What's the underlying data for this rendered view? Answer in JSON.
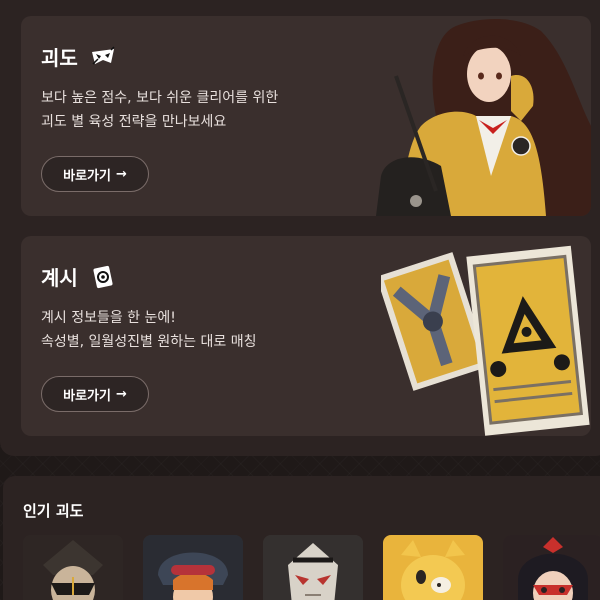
{
  "cards": [
    {
      "title": "괴도",
      "icon": "mask-icon",
      "desc_line1": "보다 높은 점수, 보다 쉬운 클리어를 위한",
      "desc_line2": "괴도 별 육성 전략을 만나보세요",
      "button_label": "바로가기",
      "button_arrow": "→"
    },
    {
      "title": "계시",
      "icon": "revelation-card-icon",
      "desc_line1": "계시 정보들을 한 눈에!",
      "desc_line2": "속성별, 일월성진별 원하는 대로 매칭",
      "button_label": "바로가기",
      "button_arrow": "→"
    }
  ],
  "popular": {
    "title": "인기 괴도",
    "thumbnails": [
      {
        "name": "thief-portrait-1"
      },
      {
        "name": "thief-portrait-2"
      },
      {
        "name": "thief-portrait-3"
      },
      {
        "name": "thief-portrait-4"
      },
      {
        "name": "thief-portrait-5"
      }
    ]
  },
  "colors": {
    "background": "#1f1918",
    "panel": "#2c2322",
    "card": "#3a2f2d",
    "button_border": "#7a6c69",
    "accent_gold": "#d9a93a"
  }
}
